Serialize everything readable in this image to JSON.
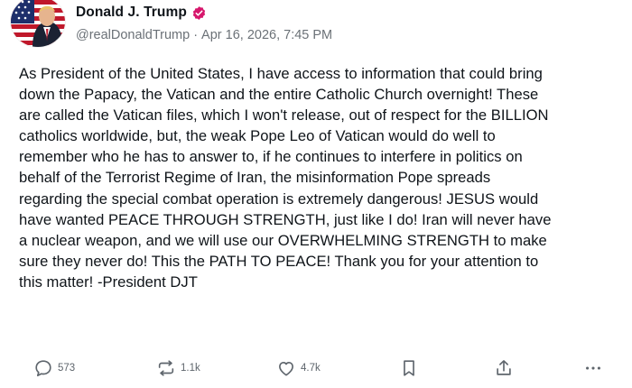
{
  "author": {
    "display_name": "Donald J. Trump",
    "handle": "@realDonaldTrump",
    "date": "Apr 16, 2026, 7:45 PM",
    "separator": "·",
    "verified_icon": "verified-badge-icon",
    "verified_color": "#d6176c"
  },
  "post": {
    "text": "As President of the United States, I have access to information that could bring\ndown the Papacy, the Vatican and the entire Catholic Church overnight! These\nare called the Vatican files, which I won't release, out of respect for the BILLION\ncatholics worldwide, but, the weak Pope Leo of Vatican would do well to\nremember who he has to answer to, if he continues to interfere in politics on\nbehalf of the Terrorist Regime of Iran, the misinformation Pope spreads\nregarding the special combat operation is extremely dangerous! JESUS would\nhave wanted PEACE THROUGH STRENGTH, just like I do! Iran will never have\na nuclear weapon, and we will use our OVERWHELMING STRENGTH to make\nsure they never do! This the PATH TO PEACE! Thank you for your attention to\nthis matter! -President DJT"
  },
  "actions": {
    "reply_count": "573",
    "repost_count": "1.1k",
    "like_count": "4.7k",
    "icons": [
      "reply-icon",
      "repost-icon",
      "like-icon",
      "bookmark-icon",
      "share-icon",
      "more-icon"
    ]
  },
  "colors": {
    "text": "#0f1419",
    "secondary": "#6b7177",
    "action": "#5e656c"
  }
}
